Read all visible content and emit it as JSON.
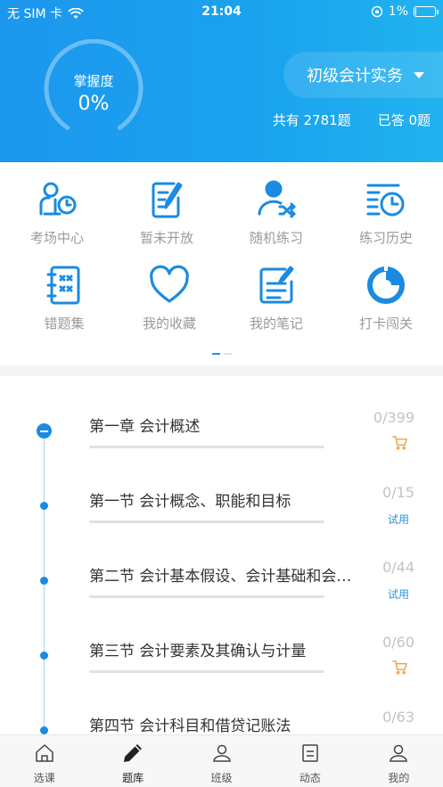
{
  "status_bar": {
    "carrier": "无 SIM 卡",
    "time": "21:04",
    "battery": "1%"
  },
  "header": {
    "mastery_label": "掌握度",
    "mastery_value": "0%",
    "subject": "初级会计实务",
    "total_questions": "共有 2781题",
    "answered": "已答 0题"
  },
  "grid": {
    "items": [
      {
        "label": "考场中心",
        "icon": "exam-center-icon"
      },
      {
        "label": "暂未开放",
        "icon": "edit-note-icon"
      },
      {
        "label": "随机练习",
        "icon": "random-practice-icon"
      },
      {
        "label": "练习历史",
        "icon": "history-clock-icon"
      },
      {
        "label": "错题集",
        "icon": "wrong-questions-icon"
      },
      {
        "label": "我的收藏",
        "icon": "heart-icon"
      },
      {
        "label": "我的笔记",
        "icon": "notes-icon"
      },
      {
        "label": "打卡闯关",
        "icon": "pie-checkin-icon"
      }
    ],
    "page_indicator": {
      "pages": 2,
      "current": 1
    }
  },
  "chapters": [
    {
      "title": "第一章 会计概述",
      "count": "0/399",
      "badge": "cart"
    },
    {
      "title": "第一节 会计概念、职能和目标",
      "count": "0/15",
      "badge": "试用"
    },
    {
      "title": "第二节 会计基本假设、会计基础和会计信息质量要求",
      "count": "0/44",
      "badge": "试用"
    },
    {
      "title": "第三节 会计要素及其确认与计量",
      "count": "0/60",
      "badge": "cart"
    },
    {
      "title": "第四节 会计科目和借贷记账法",
      "count": "0/63",
      "badge": ""
    }
  ],
  "tabbar": {
    "items": [
      {
        "label": "选课",
        "icon": "home-icon"
      },
      {
        "label": "题库",
        "icon": "pencil-icon",
        "active": true
      },
      {
        "label": "班级",
        "icon": "class-group-icon"
      },
      {
        "label": "动态",
        "icon": "news-doc-icon"
      },
      {
        "label": "我的",
        "icon": "profile-icon"
      }
    ]
  },
  "colors": {
    "primary": "#1a8be0",
    "header_start": "#1c97ee",
    "header_end": "#21b3ef",
    "cart": "#f0a23a"
  }
}
